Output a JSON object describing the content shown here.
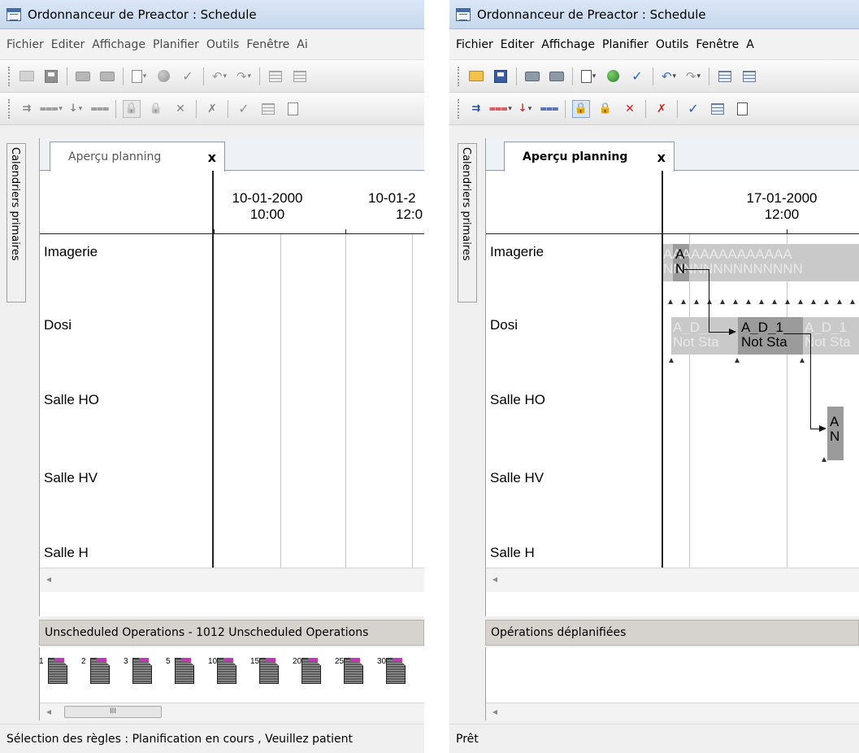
{
  "left": {
    "title": "Ordonnanceur de Preactor : Schedule",
    "menu": [
      "Fichier",
      "Editer",
      "Affichage",
      "Planifier",
      "Outils",
      "Fenêtre",
      "Ai"
    ],
    "sidebar_tab": "Calendriers primaires",
    "doc_tab": {
      "label": "Aperçu planning",
      "close": "x"
    },
    "time_headers": [
      {
        "date": "10-01-2000",
        "time": "10:00"
      },
      {
        "date": "10-01-2",
        "time": "12:0"
      }
    ],
    "resources": [
      "Imagerie",
      "Dosi",
      "Salle HO",
      "Salle HV",
      "Salle H"
    ],
    "unscheduled_header": "Unscheduled Operations - 1012 Unscheduled Operations",
    "unscheduled_ops": [
      "1",
      "2",
      "3",
      "5",
      "10",
      "15",
      "20",
      "25",
      "30"
    ],
    "scroll_thumb": "III",
    "status": "Sélection des règles : Planification en cours , Veuillez patient"
  },
  "right": {
    "title": "Ordonnanceur de Preactor : Schedule",
    "menu": [
      "Fichier",
      "Editer",
      "Affichage",
      "Planifier",
      "Outils",
      "Fenêtre",
      "A"
    ],
    "sidebar_tab": "Calendriers primaires",
    "doc_tab": {
      "label": "Aperçu planning",
      "close": "x"
    },
    "time_headers": [
      {
        "date": "17-01-2000",
        "time": "12:00"
      }
    ],
    "resources": [
      "Imagerie",
      "Dosi",
      "Salle HO",
      "Salle HV",
      "Salle H"
    ],
    "bars": {
      "imagerie_top": "AAAAAAAAAAAAAA",
      "imagerie_bottom": "NNNNNNNNNNNNNN",
      "imagerie_selected_top": "A",
      "imagerie_selected_bottom": "N",
      "dosi_ghost_1_top": "A_D_",
      "dosi_ghost_1_bottom": "Not Sta",
      "dosi_selected_top": "A_D_1",
      "dosi_selected_bottom": "Not Sta",
      "dosi_ghost_2_top": "A_D_1",
      "dosi_ghost_2_bottom": "Not Sta",
      "salleho_top": "A",
      "salleho_bottom": "N"
    },
    "unscheduled_header": "Opérations déplanifiées",
    "status": "Prêt"
  },
  "icons": [
    "open-folder-icon",
    "save-icon",
    "print-preview-icon",
    "print-icon",
    "new-page-icon",
    "globe-icon",
    "check-icon",
    "undo-icon",
    "redo-icon",
    "grid-view-icon",
    "sort-icon",
    "lock-icon",
    "unlock-icon",
    "delete-icon",
    "checklist-icon",
    "calculator-icon"
  ]
}
